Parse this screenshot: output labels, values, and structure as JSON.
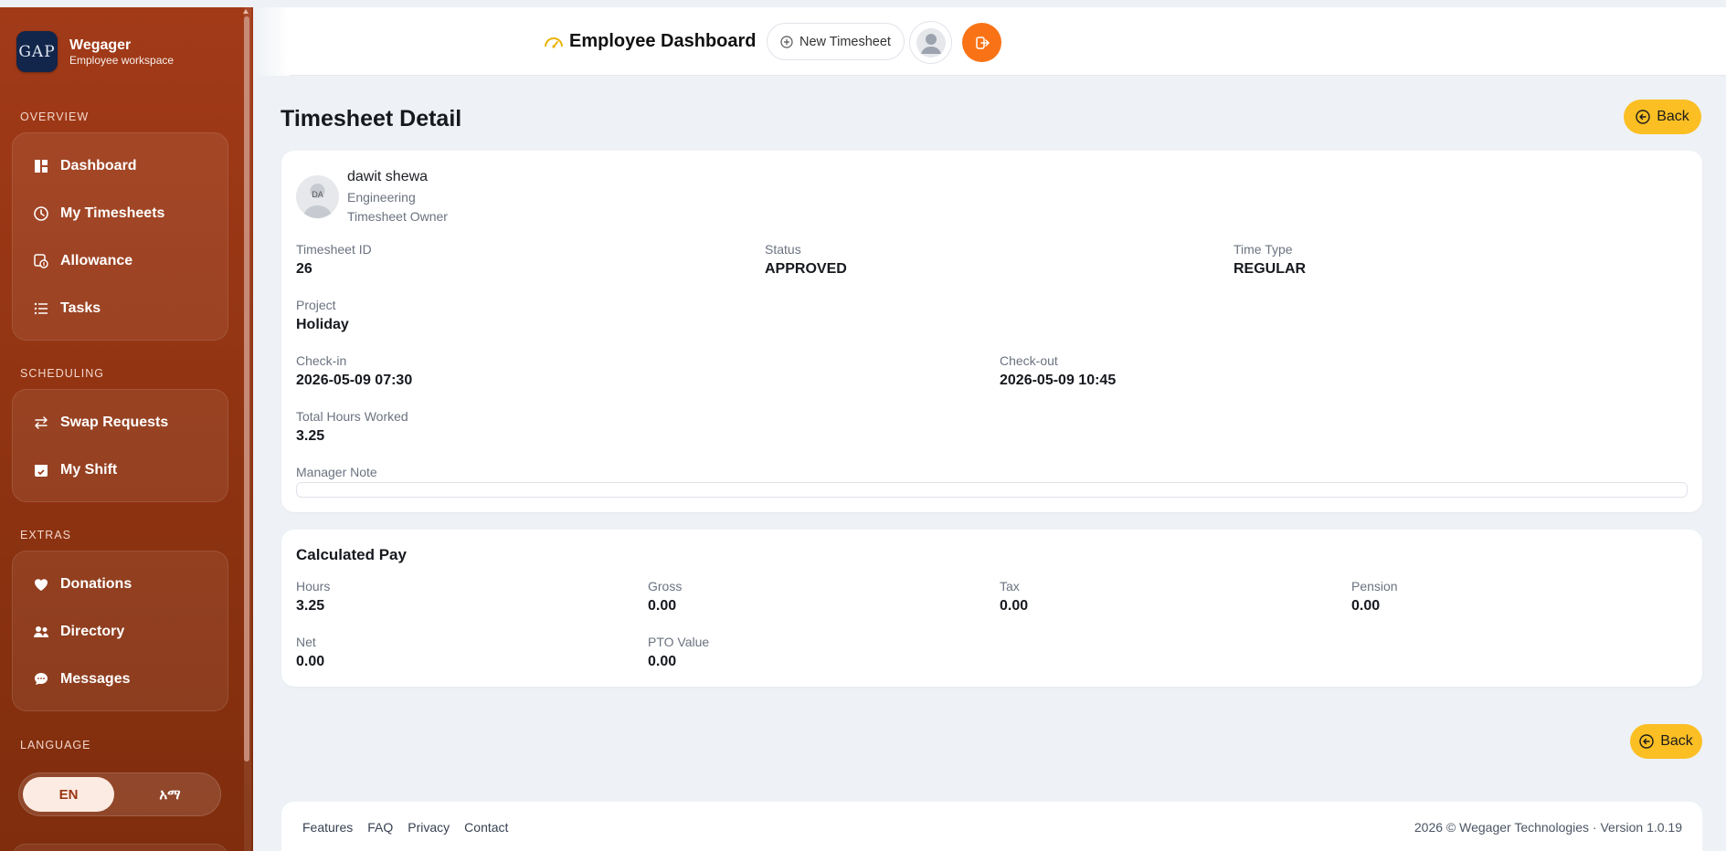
{
  "sidebar": {
    "brand": {
      "logo_text": "GAP",
      "name": "Wegager",
      "subtitle": "Employee workspace"
    },
    "sections": [
      {
        "label": "OVERVIEW",
        "items": [
          {
            "label": "Dashboard",
            "icon": "dashboard-icon"
          },
          {
            "label": "My Timesheets",
            "icon": "clock-icon"
          },
          {
            "label": "Allowance",
            "icon": "allowance-icon"
          },
          {
            "label": "Tasks",
            "icon": "list-icon"
          }
        ]
      },
      {
        "label": "SCHEDULING",
        "items": [
          {
            "label": "Swap Requests",
            "icon": "swap-icon"
          },
          {
            "label": "My Shift",
            "icon": "calendar-icon"
          }
        ]
      },
      {
        "label": "EXTRAS",
        "items": [
          {
            "label": "Donations",
            "icon": "heart-icon"
          },
          {
            "label": "Directory",
            "icon": "people-icon"
          },
          {
            "label": "Messages",
            "icon": "chat-icon"
          }
        ]
      }
    ],
    "language": {
      "label": "LANGUAGE",
      "options": [
        "EN",
        "አማ"
      ],
      "selected": "EN"
    }
  },
  "header": {
    "title": "Employee Dashboard",
    "new_timesheet_label": "New Timesheet"
  },
  "page": {
    "title": "Timesheet Detail",
    "back_label": "Back"
  },
  "owner": {
    "initials": "DA",
    "name": "dawit shewa",
    "department": "Engineering",
    "role": "Timesheet Owner"
  },
  "details": {
    "timesheet_id": {
      "label": "Timesheet ID",
      "value": "26"
    },
    "status": {
      "label": "Status",
      "value": "APPROVED"
    },
    "time_type": {
      "label": "Time Type",
      "value": "REGULAR"
    },
    "project": {
      "label": "Project",
      "value": "Holiday"
    },
    "check_in": {
      "label": "Check-in",
      "value": "2026-05-09 07:30"
    },
    "check_out": {
      "label": "Check-out",
      "value": "2026-05-09 10:45"
    },
    "total_hours": {
      "label": "Total Hours Worked",
      "value": "3.25"
    },
    "manager_note": {
      "label": "Manager Note",
      "value": ""
    }
  },
  "pay": {
    "title": "Calculated Pay",
    "hours": {
      "label": "Hours",
      "value": "3.25"
    },
    "gross": {
      "label": "Gross",
      "value": "0.00"
    },
    "tax": {
      "label": "Tax",
      "value": "0.00"
    },
    "pension": {
      "label": "Pension",
      "value": "0.00"
    },
    "net": {
      "label": "Net",
      "value": "0.00"
    },
    "pto_value": {
      "label": "PTO Value",
      "value": "0.00"
    }
  },
  "footer": {
    "links": [
      "Features",
      "FAQ",
      "Privacy",
      "Contact"
    ],
    "copyright": "2026 © Wegager Technologies · Version 1.0.19"
  },
  "colors": {
    "sidebar": "#9a3412",
    "accent_orange": "#f97316",
    "back_button": "#fbbf24",
    "background": "#eef1f5"
  }
}
